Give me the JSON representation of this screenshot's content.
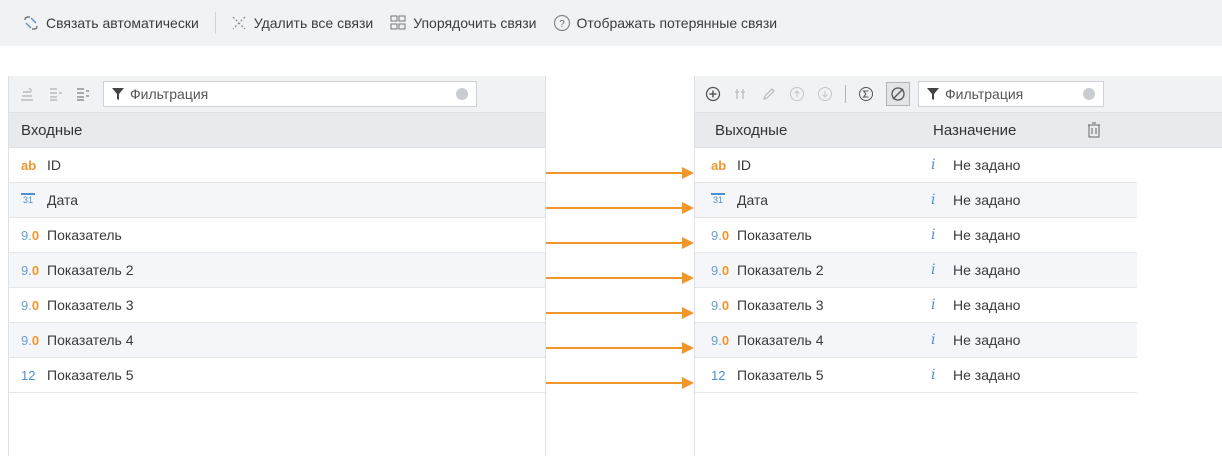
{
  "toolbar": {
    "link_auto": "Связать автоматически",
    "delete_all": "Удалить все связи",
    "order_links": "Упорядочить связи",
    "show_lost": "Отображать потерянные связи"
  },
  "left": {
    "filter_placeholder": "Фильтрация",
    "header": "Входные",
    "rows": [
      {
        "type": "ab",
        "name": "ID"
      },
      {
        "type": "date",
        "name": "Дата"
      },
      {
        "type": "num",
        "name": "Показатель"
      },
      {
        "type": "num",
        "name": "Показатель 2"
      },
      {
        "type": "num",
        "name": "Показатель 3"
      },
      {
        "type": "num",
        "name": "Показатель 4"
      },
      {
        "type": "int",
        "name": "Показатель 5"
      }
    ]
  },
  "right": {
    "filter_placeholder": "Фильтрация",
    "header_out": "Выходные",
    "header_dest": "Назначение",
    "rows": [
      {
        "type": "ab",
        "name": "ID",
        "dest": "Не задано"
      },
      {
        "type": "date",
        "name": "Дата",
        "dest": "Не задано"
      },
      {
        "type": "num",
        "name": "Показатель",
        "dest": "Не задано"
      },
      {
        "type": "num",
        "name": "Показатель 2",
        "dest": "Не задано"
      },
      {
        "type": "num",
        "name": "Показатель 3",
        "dest": "Не задано"
      },
      {
        "type": "num",
        "name": "Показатель 4",
        "dest": "Не задано"
      },
      {
        "type": "int",
        "name": "Показатель 5",
        "dest": "Не задано"
      }
    ]
  },
  "type_labels": {
    "ab": "ab",
    "date": "31",
    "num_a": "9.",
    "num_b": "0",
    "int": "12"
  },
  "colors": {
    "arrow": "#f0962a",
    "accent_blue": "#4e8fcf"
  }
}
